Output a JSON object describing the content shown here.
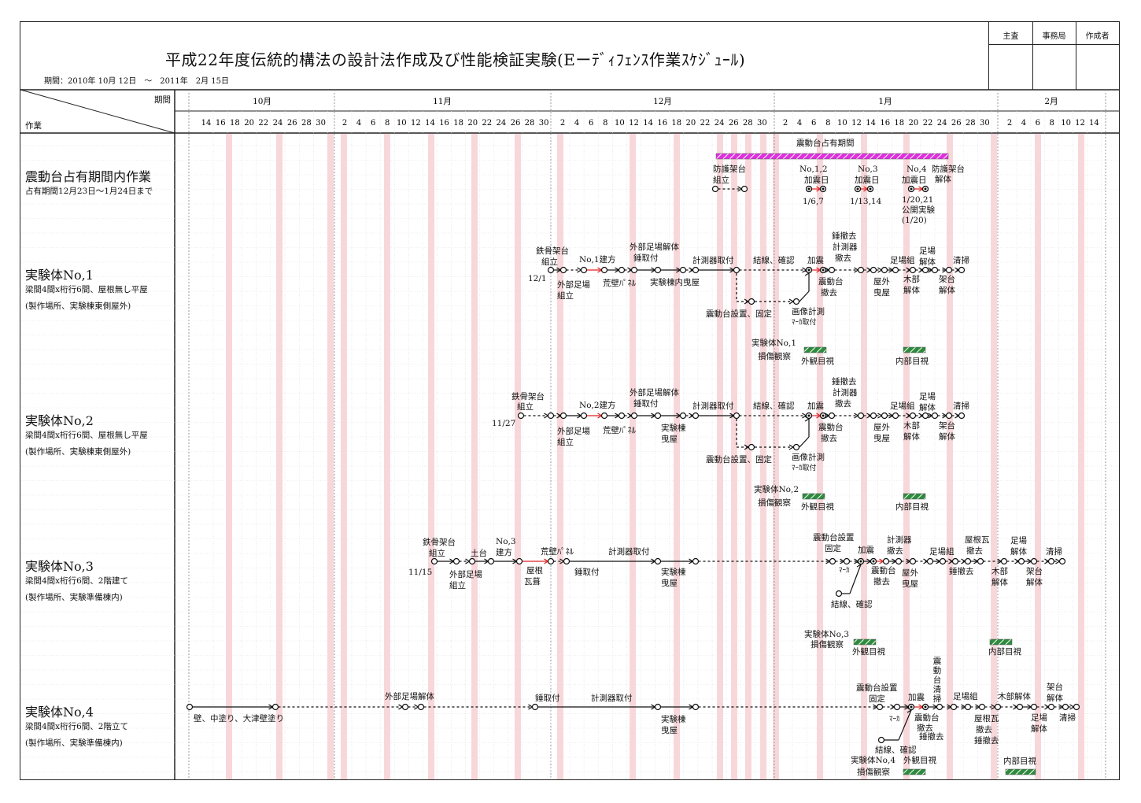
{
  "header": {
    "title": "平成22年度伝統的構法の設計法作成及び性能検証実験(Eーﾃﾞｨﾌｪﾝｽ作業ｽｹｼﾞｭｰﾙ)",
    "period": "期間：2010年 10月 12日　～　2011年　2月 15日",
    "approval": [
      "主査",
      "事務局",
      "作成者"
    ],
    "col_period": "期間",
    "col_task": "作業"
  },
  "months": [
    "10月",
    "11月",
    "12月",
    "1月",
    "2月"
  ],
  "days": [
    [
      "14",
      "16",
      "18",
      "20",
      "22",
      "24",
      "26",
      "28",
      "30"
    ],
    [
      "2",
      "4",
      "6",
      "8",
      "10",
      "12",
      "14",
      "16",
      "18",
      "20",
      "22",
      "24",
      "26",
      "28",
      "30"
    ],
    [
      "2",
      "4",
      "6",
      "8",
      "10",
      "12",
      "14",
      "16",
      "18",
      "20",
      "22",
      "24",
      "26",
      "28",
      "30"
    ],
    [
      "2",
      "4",
      "6",
      "8",
      "10",
      "12",
      "14",
      "16",
      "18",
      "20",
      "22",
      "24",
      "26",
      "28",
      "30"
    ],
    [
      "2",
      "4",
      "6",
      "8",
      "10",
      "12",
      "14"
    ]
  ],
  "tasks": [
    {
      "title": "震動台占有期間内作業",
      "sub1": "占有期間12月23日～1月24日まで",
      "sub2": ""
    },
    {
      "title": "実験体No,1",
      "sub1": "梁間4間x桁行6間、屋根無し平屋",
      "sub2": "(製作場所、実験棟東側屋外)"
    },
    {
      "title": "実験体No,2",
      "sub1": "梁間4間x桁行6間、屋根無し平屋",
      "sub2": "(製作場所、実験棟東側屋外)"
    },
    {
      "title": "実験体No,3",
      "sub1": "梁間4間x桁行6間、2階建て",
      "sub2": "(製作場所、実験準備棟内)"
    },
    {
      "title": "実験体No,4",
      "sub1": "梁間4間x桁行6間、2階立て",
      "sub2": "(製作場所、実験準備棟内)"
    }
  ],
  "a0": {
    "occupancy": "震動台占有期間",
    "frame1": "防護架台",
    "frame2": "組立",
    "s12a": "No,1,2",
    "s12b": "加震日",
    "s12d": "1/6,7",
    "s3a": "No,3",
    "s3b": "加震日",
    "s3d": "1/13,14",
    "s4a": "No,4",
    "s4b": "加震日",
    "s4d": "1/20,21",
    "s4e": "公開実験",
    "s4f": "(1/20)",
    "dis1": "防護架台",
    "dis2": "解体"
  },
  "a1": {
    "n1": "鉄骨架台",
    "n2": "組立",
    "date": "12/1",
    "scaf1": "外部足場",
    "scaf2": "組立",
    "erect": "No,1建方",
    "panel": "荒壁ﾊﾟﾈﾙ",
    "sd1": "外部足場解体",
    "sd2": "錘取付",
    "pull": "実験棟内曳屋",
    "meter": "計測器取付",
    "tie": "結線、確認",
    "shake": "加震",
    "wr1": "錘撤去",
    "wr2": "計測器",
    "wr3": "撤去",
    "tbl1": "震動台",
    "tbl2": "撤去",
    "out1": "屋外",
    "out2": "曳屋",
    "sg": "足場組",
    "sd3": "足場",
    "sd4": "解体",
    "wd1": "木部",
    "wd2": "解体",
    "clean": "清掃",
    "fr1": "架台",
    "fr2": "解体",
    "install": "震動台設置、固定",
    "img1": "画像計測",
    "img2": "ﾏｰｶ取付",
    "obs1": "実験体No,1",
    "obs2": "損傷観察",
    "ext": "外観目視",
    "int": "内部目視"
  },
  "a2": {
    "n1": "鉄骨架台",
    "n2": "組立",
    "date": "11/27",
    "scaf1": "外部足場",
    "scaf2": "組立",
    "erect": "No,2建方",
    "panel": "荒壁ﾊﾟﾈﾙ",
    "sd1": "外部足場解体",
    "sd2": "錘取付",
    "pull1": "実験棟",
    "pull2": "曳屋",
    "meter": "計測器取付",
    "tie": "結線、確認",
    "shake": "加震",
    "wr1": "錘撤去",
    "wr2": "計測器",
    "wr3": "撤去",
    "tbl1": "震動台",
    "tbl2": "撤去",
    "out1": "屋外",
    "out2": "曳屋",
    "sg": "足場組",
    "sd3": "足場",
    "sd4": "解体",
    "wd1": "木部",
    "wd2": "解体",
    "clean": "清掃",
    "fr1": "架台",
    "fr2": "解体",
    "install": "震動台設置、固定",
    "img1": "画像計測",
    "img2": "ﾏｰｶ取付",
    "obs1": "実験体No,2",
    "obs2": "損傷観察",
    "ext": "外観目視",
    "int": "内部目視"
  },
  "a3": {
    "n1": "鉄骨架台",
    "n2": "組立",
    "date": "11/15",
    "scaf1": "外部足場",
    "scaf2": "組立",
    "sill": "土台",
    "e1": "No,3",
    "e2": "建方",
    "panel": "荒壁ﾊﾟﾈﾙ",
    "roof1": "屋根",
    "roof2": "瓦葺",
    "weight": "錘取付",
    "meter": "計測器取付",
    "pull1": "実験棟",
    "pull2": "曳屋",
    "inst1": "震動台設置",
    "inst2": "固定",
    "marker": "ﾏｰｶ",
    "shake": "加震",
    "tbl1": "震動台",
    "tbl2": "撤去",
    "mt1": "計測器",
    "mt2": "撤去",
    "out1": "屋外",
    "out2": "曳屋",
    "sg": "足場組",
    "wr": "錘撤去",
    "rt1": "屋根瓦",
    "rt2": "撤去",
    "wd1": "木部",
    "wd2": "解体",
    "sd1": "足場",
    "sd2": "解体",
    "fr1": "架台",
    "fr2": "解体",
    "clean": "清掃",
    "tie": "結線、確認",
    "obs1": "実験体No,3",
    "obs2": "損傷観察",
    "ext": "外観目視",
    "int": "内部目視"
  },
  "a4": {
    "wall": "壁、中塗り、大津壁塗り",
    "sd": "外部足場解体",
    "weight": "錘取付",
    "meter": "計測器取付",
    "pull1": "実験棟",
    "pull2": "曳屋",
    "inst1": "震動台設置",
    "inst2": "固定",
    "marker": "ﾏｰｶ",
    "shake": "加震",
    "tbl1": "震動台",
    "tbl2": "撤去",
    "wr": "錘撤去",
    "vert": "震動台清掃",
    "sg": "足場組",
    "rt1": "屋根瓦",
    "rt2": "撤去",
    "wr2": "錘撤去",
    "wd": "木部解体",
    "sd1": "足場",
    "sd2": "解体",
    "fr1": "架台",
    "fr2": "解体",
    "clean": "清掃",
    "tie": "結線、確認",
    "obs1": "実験体No,4",
    "obs2": "損傷観察",
    "ext": "外観目視",
    "int": "内部目視"
  },
  "colors": {
    "stripe": "#f8d7da",
    "occupancy": "#e030e0",
    "observation": "#2e8b3e",
    "arrow_red": "#e02020"
  }
}
